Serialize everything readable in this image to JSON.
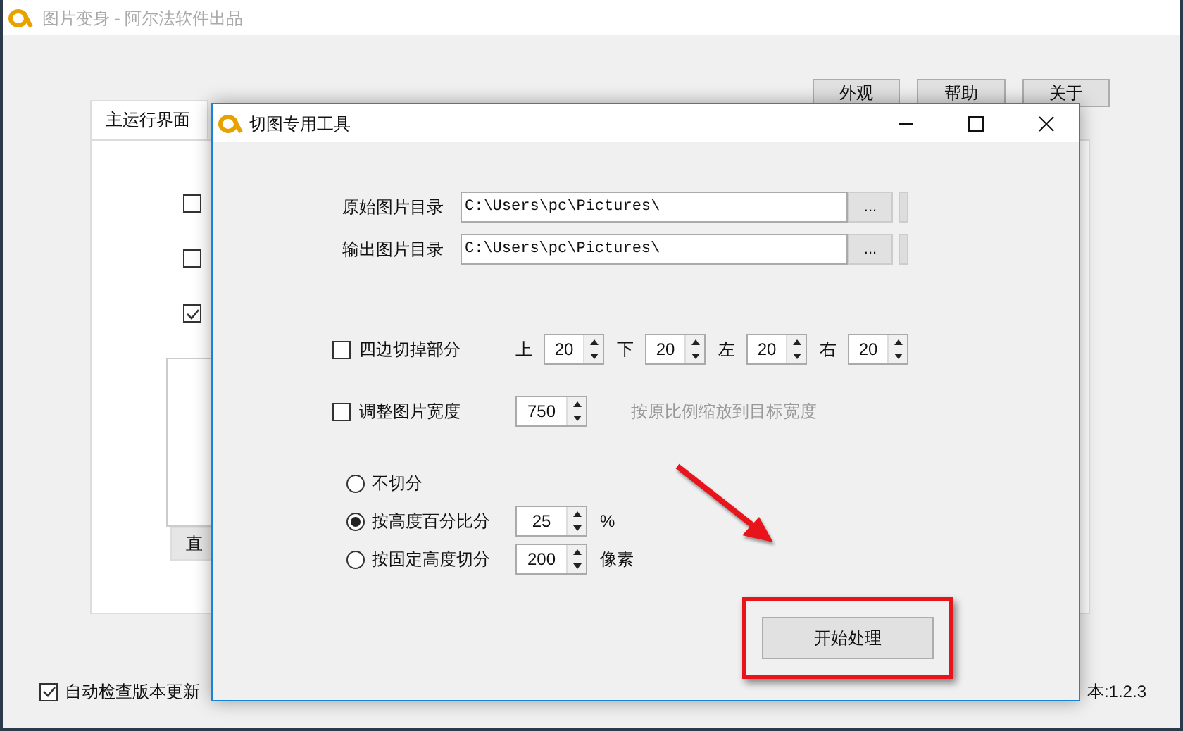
{
  "main_window": {
    "title": "图片变身 - 阿尔法软件出品",
    "top_buttons": [
      "外观",
      "帮助",
      "关于"
    ],
    "tabs": [
      {
        "label": "主运行界面",
        "selected": true
      }
    ],
    "options": [
      {
        "checked": false
      },
      {
        "checked": false
      },
      {
        "checked": true
      }
    ],
    "cut_button": "直",
    "auto_update": {
      "label": "自动检查版本更新",
      "checked": true
    },
    "version": "本:1.2.3"
  },
  "dialog": {
    "title": "切图专用工具",
    "paths": [
      {
        "label": "原始图片目录",
        "value": "C:\\Users\\pc\\Pictures\\",
        "browse": "..."
      },
      {
        "label": "输出图片目录",
        "value": "C:\\Users\\pc\\Pictures\\",
        "browse": "..."
      }
    ],
    "trim": {
      "label": "四边切掉部分",
      "checked": false,
      "sides": [
        {
          "label": "上",
          "value": "20"
        },
        {
          "label": "下",
          "value": "20"
        },
        {
          "label": "左",
          "value": "20"
        },
        {
          "label": "右",
          "value": "20"
        }
      ]
    },
    "resize": {
      "label": "调整图片宽度",
      "checked": false,
      "value": "750",
      "hint": "按原比例缩放到目标宽度"
    },
    "split_modes": [
      {
        "label": "不切分",
        "selected": false
      },
      {
        "label": "按高度百分比分",
        "selected": true,
        "value": "25",
        "unit": "%"
      },
      {
        "label": "按固定高度切分",
        "selected": false,
        "value": "200",
        "unit": "像素"
      }
    ],
    "start_button": "开始处理"
  }
}
